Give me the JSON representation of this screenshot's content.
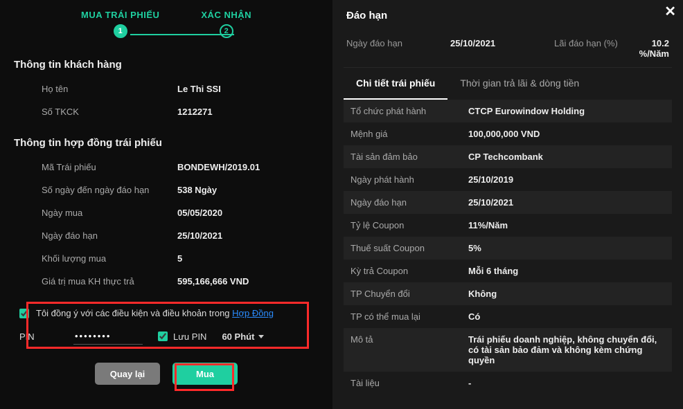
{
  "left": {
    "stepper": {
      "step1": "MUA TRÁI PHIẾU",
      "step2": "XÁC NHẬN",
      "num1": "1",
      "num2": "2"
    },
    "customer_section_title": "Thông tin khách hàng",
    "bond_section_title": "Thông tin hợp đồng trái phiếu",
    "customer": {
      "name_label": "Họ tên",
      "name_value": "Le Thi SSI",
      "acct_label": "Số TKCK",
      "acct_value": "1212271"
    },
    "bond": {
      "code_label": "Mã Trái phiếu",
      "code_value": "BONDEWH/2019.01",
      "dtm_label": "Số ngày đến ngày đáo hạn",
      "dtm_value": "538 Ngày",
      "buy_date_label": "Ngày mua",
      "buy_date_value": "05/05/2020",
      "mat_date_label": "Ngày đáo hạn",
      "mat_date_value": "25/10/2021",
      "qty_label": "Khối lượng mua",
      "qty_value": "5",
      "price_label": "Giá trị mua KH thực trả",
      "price_value": "595,166,666 VND"
    },
    "agreement": {
      "text_before": "Tôi đồng ý với các điều kiện và điều khoản trong ",
      "link": "Hợp Đồng"
    },
    "pin": {
      "label": "PIN",
      "value": "••••••••",
      "save_label": "Lưu PIN",
      "duration": "60 Phút"
    },
    "buttons": {
      "back": "Quay lại",
      "buy": "Mua"
    }
  },
  "right": {
    "close": "✕",
    "title": "Đáo hạn",
    "summary": {
      "date_label": "Ngày đáo hạn",
      "date_value": "25/10/2021",
      "rate_label": "Lãi đáo hạn (%)",
      "rate_value": "10.2 %/Năm"
    },
    "tabs": {
      "t1": "Chi tiết trái phiếu",
      "t2": "Thời gian trả lãi & dòng tiền"
    },
    "details": {
      "issuer_label": "Tổ chức phát hành",
      "issuer_value": "CTCP Eurowindow Holding",
      "par_label": "Mệnh giá",
      "par_value": "100,000,000 VND",
      "collat_label": "Tài sản đảm bảo",
      "collat_value": "CP Techcombank",
      "issue_date_label": "Ngày phát hành",
      "issue_date_value": "25/10/2019",
      "mat_date_label": "Ngày đáo hạn",
      "mat_date_value": "25/10/2021",
      "coupon_label": "Tỷ lệ Coupon",
      "coupon_value": "11%/Năm",
      "tax_label": "Thuế suất Coupon",
      "tax_value": "5%",
      "period_label": "Kỳ trả Coupon",
      "period_value": "Mỗi 6 tháng",
      "convert_label": "TP Chuyển đổi",
      "convert_value": "Không",
      "callable_label": "TP có thể mua lại",
      "callable_value": "Có",
      "desc_label": "Mô tả",
      "desc_value": "Trái phiếu doanh nghiệp, không chuyển đổi, có tài sản bảo đảm và không kèm chứng quyền",
      "docs_label": "Tài liệu",
      "docs_value": "-"
    }
  }
}
